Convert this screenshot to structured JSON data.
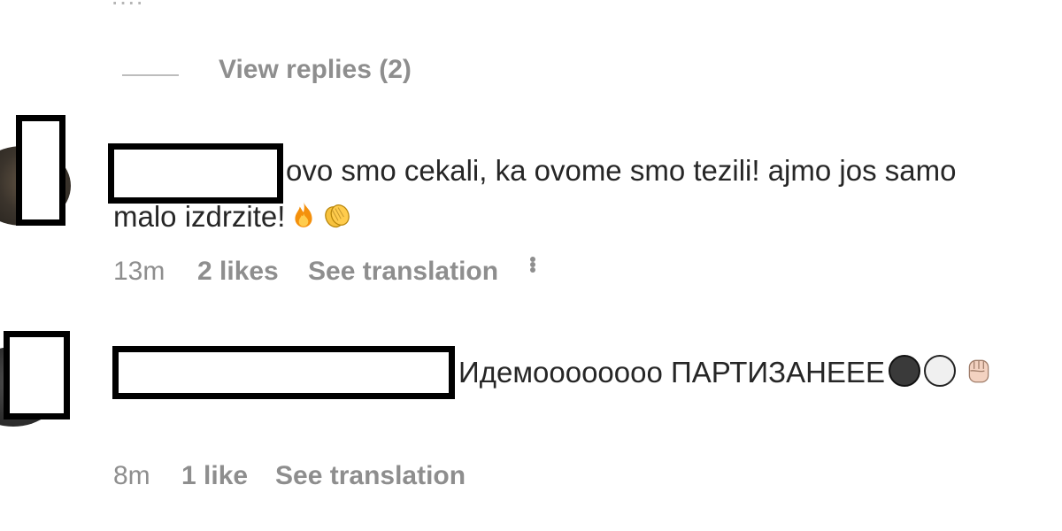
{
  "top_cutoff": "····",
  "view_replies": {
    "label": "View replies (2)"
  },
  "comments": [
    {
      "text": "ovo smo cekali, ka ovome smo tezili! ajmo jos samo malo izdrzite!",
      "emojis": [
        "fire-emoji",
        "clapping-hands-emoji"
      ],
      "time": "13m",
      "likes": "2 likes",
      "translate": "See translation",
      "more": "more-options-icon"
    },
    {
      "text": "Идемоооооооо ПАРТИЗАНЕЕЕ",
      "emojis": [
        "black-circle-emoji",
        "white-circle-emoji",
        "raised-fist-emoji"
      ],
      "time": "8m",
      "likes": "1 like",
      "translate": "See translation"
    }
  ],
  "colors": {
    "text": "#262626",
    "secondary": "#8e8e8e",
    "redaction_border": "#000000"
  }
}
